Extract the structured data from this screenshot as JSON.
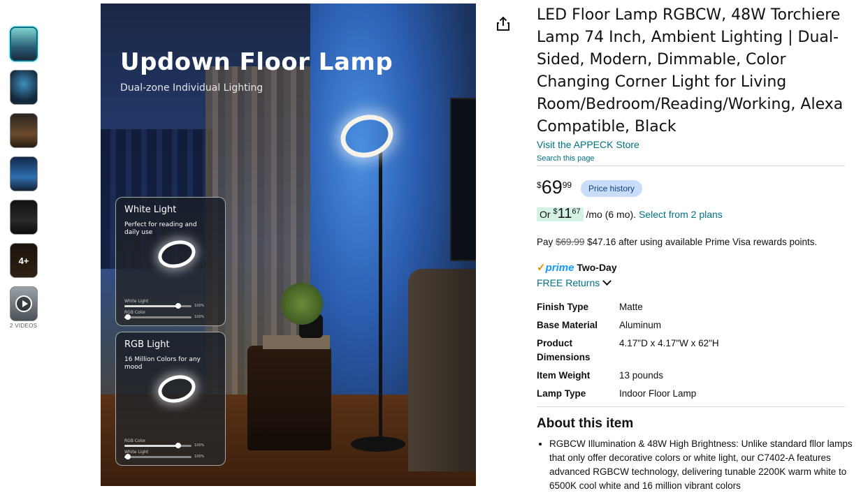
{
  "product": {
    "title": "LED Floor Lamp RGBCW, 48W Torchiere Lamp 74 Inch, Ambient Lighting | Dual-Sided, Modern, Dimmable, Color Changing Corner Light for Living Room/Bedroom/Reading/Working, Alexa Compatible, Black",
    "store_link": "Visit the APPECK Store",
    "search_page": "Search this page"
  },
  "gallery": {
    "thumbnail_count": 7,
    "more_label": "4+",
    "videos_label": "2 VIDEOS",
    "main_image": {
      "heading": "Updown Floor Lamp",
      "subheading": "Dual-zone Individual Lighting",
      "card1": {
        "title": "White Light",
        "desc": "Perfect for reading and daily use",
        "slider1_label": "White Light",
        "slider1_value": "100%",
        "slider1_level": 0.8,
        "slider2_label": "RGB Color",
        "slider2_value": "100%",
        "slider2_level": 0.05
      },
      "card2": {
        "title": "RGB Light",
        "desc": "16 Million Colors for any mood",
        "slider1_label": "RGB Color",
        "slider1_value": "100%",
        "slider1_level": 0.8,
        "slider2_label": "White Light",
        "slider2_value": "100%",
        "slider2_level": 0.05
      }
    }
  },
  "pricing": {
    "currency": "$",
    "whole": "69",
    "fraction": "99",
    "price_history": "Price history",
    "monthly_prefix": "Or",
    "monthly_symbol": "$",
    "monthly_whole": "11",
    "monthly_fraction": "67",
    "monthly_suffix": "/mo (6 mo).",
    "monthly_link": "Select from 2 plans",
    "pay_prefix": "Pay",
    "pay_original": "$69.99",
    "pay_rest": "$47.16 after using available Prime Visa rewards points."
  },
  "delivery": {
    "prime_word": "prime",
    "prime_speed": "Two-Day",
    "returns": "FREE Returns"
  },
  "specs": [
    {
      "key": "Finish Type",
      "value": "Matte"
    },
    {
      "key": "Base Material",
      "value": "Aluminum"
    },
    {
      "key": "Product Dimensions",
      "value": "4.17\"D x 4.17\"W x 62\"H"
    },
    {
      "key": "Item Weight",
      "value": "13 pounds"
    },
    {
      "key": "Lamp Type",
      "value": "Indoor Floor Lamp"
    }
  ],
  "about": {
    "heading": "About this item",
    "bullets": [
      "RGBCW Illumination & 48W High Brightness: Unlike standard fllor lamps that only offer decorative colors or white light, our C7402-A features advanced RGBCW technology, delivering tunable 2200K warm white to 6500K cool white and 16 million vibrant colors"
    ]
  },
  "colors": {
    "link": "#007185",
    "badge_bg": "#c9ddfb",
    "monthly_highlight": "#d4f2e4",
    "prime_blue": "#1399ff",
    "prime_check": "#f08804"
  }
}
